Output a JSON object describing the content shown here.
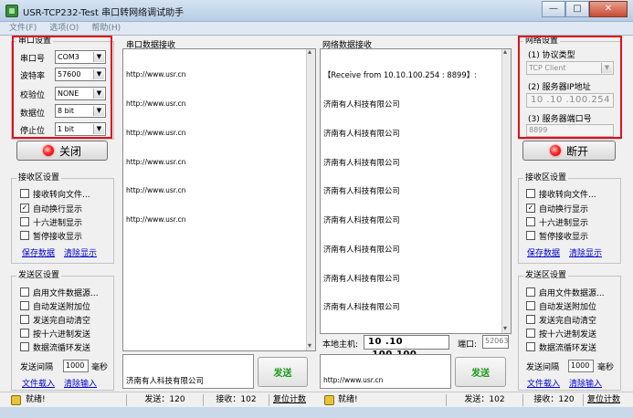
{
  "window": {
    "title": "USR-TCP232-Test 串口转网络调试助手",
    "buttons": {
      "minimize": "—",
      "maximize": "□",
      "close": "✕"
    }
  },
  "menu": [
    {
      "label": "文件(F)"
    },
    {
      "label": "选项(O)"
    },
    {
      "label": "帮助(H)"
    }
  ],
  "serial_settings": {
    "title": "串口设置",
    "port_label": "串口号",
    "port_value": "COM3",
    "baud_label": "波特率",
    "baud_value": "57600",
    "parity_label": "校验位",
    "parity_value": "NONE",
    "databits_label": "数据位",
    "databits_value": "8 bit",
    "stopbits_label": "停止位",
    "stopbits_value": "1 bit",
    "toggle_button": "关闭"
  },
  "left_receive_settings": {
    "title": "接收区设置",
    "options": [
      {
        "label": "接收转向文件...",
        "checked": ""
      },
      {
        "label": "自动换行显示",
        "checked": "✓"
      },
      {
        "label": "十六进制显示",
        "checked": ""
      },
      {
        "label": "暂停接收显示",
        "checked": ""
      }
    ],
    "save_link": "保存数据",
    "clear_link": "清除显示"
  },
  "left_send_settings": {
    "title": "发送区设置",
    "options": [
      {
        "label": "启用文件数据源...",
        "checked": ""
      },
      {
        "label": "自动发送附加位",
        "checked": ""
      },
      {
        "label": "发送完自动清空",
        "checked": ""
      },
      {
        "label": "按十六进制发送",
        "checked": ""
      },
      {
        "label": "数据流循环发送",
        "checked": ""
      }
    ],
    "interval_label": "发送间隔",
    "interval_value": "1000",
    "interval_unit": "毫秒",
    "file_link": "文件载入",
    "clear_link": "清除输入"
  },
  "serial_receive": {
    "title": "串口数据接收",
    "lines": [
      "http://www.usr.cn",
      "http://www.usr.cn",
      "http://www.usr.cn",
      "http://www.usr.cn",
      "http://www.usr.cn",
      "http://www.usr.cn"
    ]
  },
  "serial_send": {
    "text": "济南有人科技有限公司",
    "button": "发送"
  },
  "network_receive": {
    "title": "网络数据接收",
    "lines": [
      "【Receive from 10.10.100.254 : 8899】:",
      "济南有人科技有限公司",
      "济南有人科技有限公司",
      "济南有人科技有限公司",
      "济南有人科技有限公司",
      "济南有人科技有限公司",
      "济南有人科技有限公司",
      "济南有人科技有限公司",
      "济南有人科技有限公司"
    ]
  },
  "local_host": {
    "label": "本地主机:",
    "ip": "10 .10 .100.100",
    "port_label": "端口:",
    "port_value": "52063"
  },
  "network_send": {
    "text": "http://www.usr.cn",
    "button": "发送"
  },
  "network_settings": {
    "title": "网络设置",
    "protocol_label": "(1) 协议类型",
    "protocol_value": "TCP Client",
    "server_ip_label": "(2) 服务器IP地址",
    "server_ip_value": "10 .10 .100.254",
    "server_port_label": "(3) 服务器端口号",
    "server_port_value": "8899",
    "toggle_button": "断开"
  },
  "right_receive_settings": {
    "title": "接收区设置",
    "options": [
      {
        "label": "接收转向文件...",
        "checked": ""
      },
      {
        "label": "自动换行显示",
        "checked": "✓"
      },
      {
        "label": "十六进制显示",
        "checked": ""
      },
      {
        "label": "暂停接收显示",
        "checked": ""
      }
    ],
    "save_link": "保存数据",
    "clear_link": "清除显示"
  },
  "right_send_settings": {
    "title": "发送区设置",
    "options": [
      {
        "label": "启用文件数据源...",
        "checked": ""
      },
      {
        "label": "自动发送附加位",
        "checked": ""
      },
      {
        "label": "发送完自动清空",
        "checked": ""
      },
      {
        "label": "按十六进制发送",
        "checked": ""
      },
      {
        "label": "数据流循环发送",
        "checked": ""
      }
    ],
    "interval_label": "发送间隔",
    "interval_value": "1000",
    "interval_unit": "毫秒",
    "file_link": "文件载入",
    "clear_link": "清除输入"
  },
  "status_left": {
    "ready": "就绪!",
    "sent": "发送：120",
    "received": "接收：102",
    "reset": "复位计数"
  },
  "status_right": {
    "ready": "就绪!",
    "sent": "发送：102",
    "received": "接收：120",
    "reset": "复位计数"
  },
  "colors": {
    "highlight": "#e0101a",
    "send_button_text": "#1a9a1a",
    "link": "#0000cc"
  }
}
